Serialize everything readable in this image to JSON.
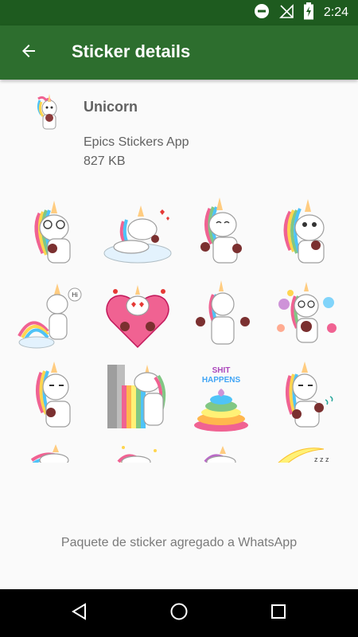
{
  "status_bar": {
    "time": "2:24",
    "icons": [
      "do-not-disturb-icon",
      "no-signal-icon",
      "battery-charging-icon"
    ]
  },
  "app_bar": {
    "title": "Sticker details",
    "back_icon": "arrow-back-icon"
  },
  "pack": {
    "name": "Unicorn",
    "publisher": "Epics Stickers App",
    "size": "827 KB"
  },
  "stickers": [
    {
      "name": "unicorn-glasses"
    },
    {
      "name": "unicorn-cloud-love"
    },
    {
      "name": "unicorn-thumbs-up"
    },
    {
      "name": "unicorn-smirk"
    },
    {
      "name": "unicorn-hi-rainbow"
    },
    {
      "name": "unicorn-heart"
    },
    {
      "name": "unicorn-shrug"
    },
    {
      "name": "unicorn-candy"
    },
    {
      "name": "unicorn-thinking"
    },
    {
      "name": "unicorn-rainbow-vomit"
    },
    {
      "name": "unicorn-poop"
    },
    {
      "name": "unicorn-annoyed"
    },
    {
      "name": "unicorn-lying"
    },
    {
      "name": "unicorn-sleeping-stars"
    },
    {
      "name": "unicorn-resting"
    },
    {
      "name": "unicorn-moon-sleep"
    }
  ],
  "poop_text": [
    "SHIT",
    "HAPPENS"
  ],
  "sticker_snippets": {
    "hi": "Hi",
    "zzz": "z z z"
  },
  "footer": {
    "message": "Paquete de sticker agregado a WhatsApp"
  },
  "nav_bar": {
    "icons": [
      "back-triangle-icon",
      "home-circle-icon",
      "recents-square-icon"
    ]
  }
}
